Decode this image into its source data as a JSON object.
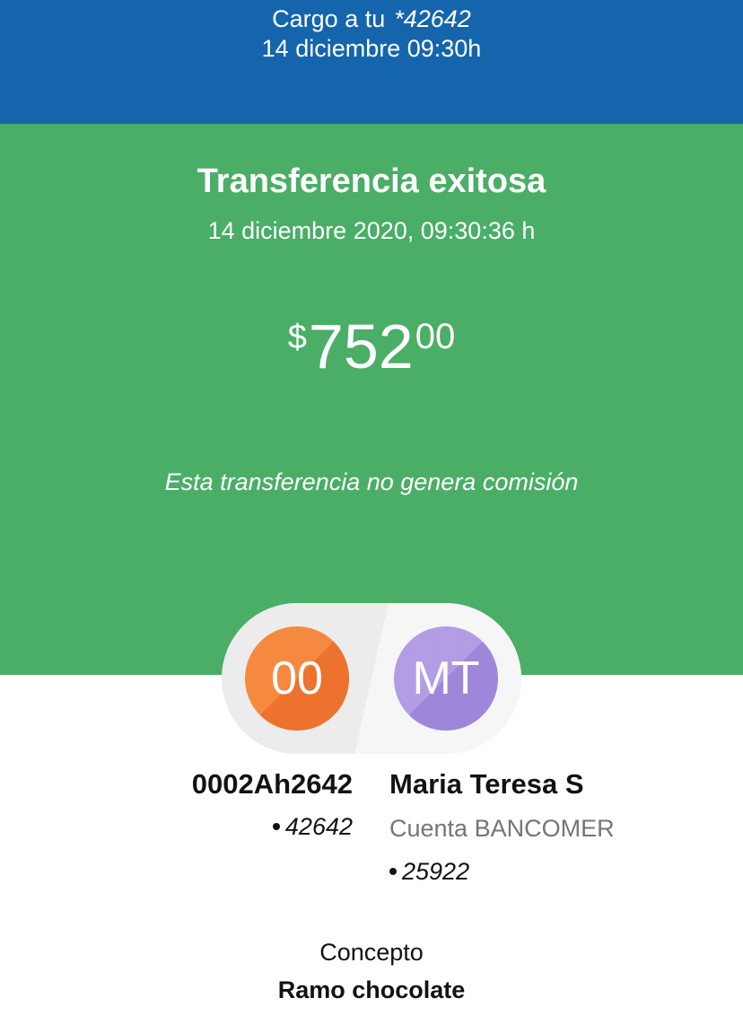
{
  "header": {
    "charge_label": "Cargo a tu",
    "account_masked": "*42642",
    "datetime": "14 diciembre 09:30h"
  },
  "status": {
    "title": "Transferencia exitosa",
    "datetime": "14 diciembre 2020, 09:30:36 h",
    "note": "Esta transferencia no genera comisión"
  },
  "amount": {
    "currency": "$",
    "integer": "752",
    "decimals": "00"
  },
  "origin": {
    "initials": "00",
    "name": "0002Ah2642",
    "account": "42642",
    "color": "#f5893f"
  },
  "destination": {
    "initials": "MT",
    "name": "Maria Teresa S",
    "bank": "Cuenta BANCOMER",
    "account": "25922",
    "color": "#a88fe0"
  },
  "concept": {
    "label": "Concepto",
    "value": "Ramo chocolate"
  },
  "colors": {
    "header_blue": "#1565ad",
    "success_green": "#4aae67",
    "muted_text": "#757575"
  }
}
